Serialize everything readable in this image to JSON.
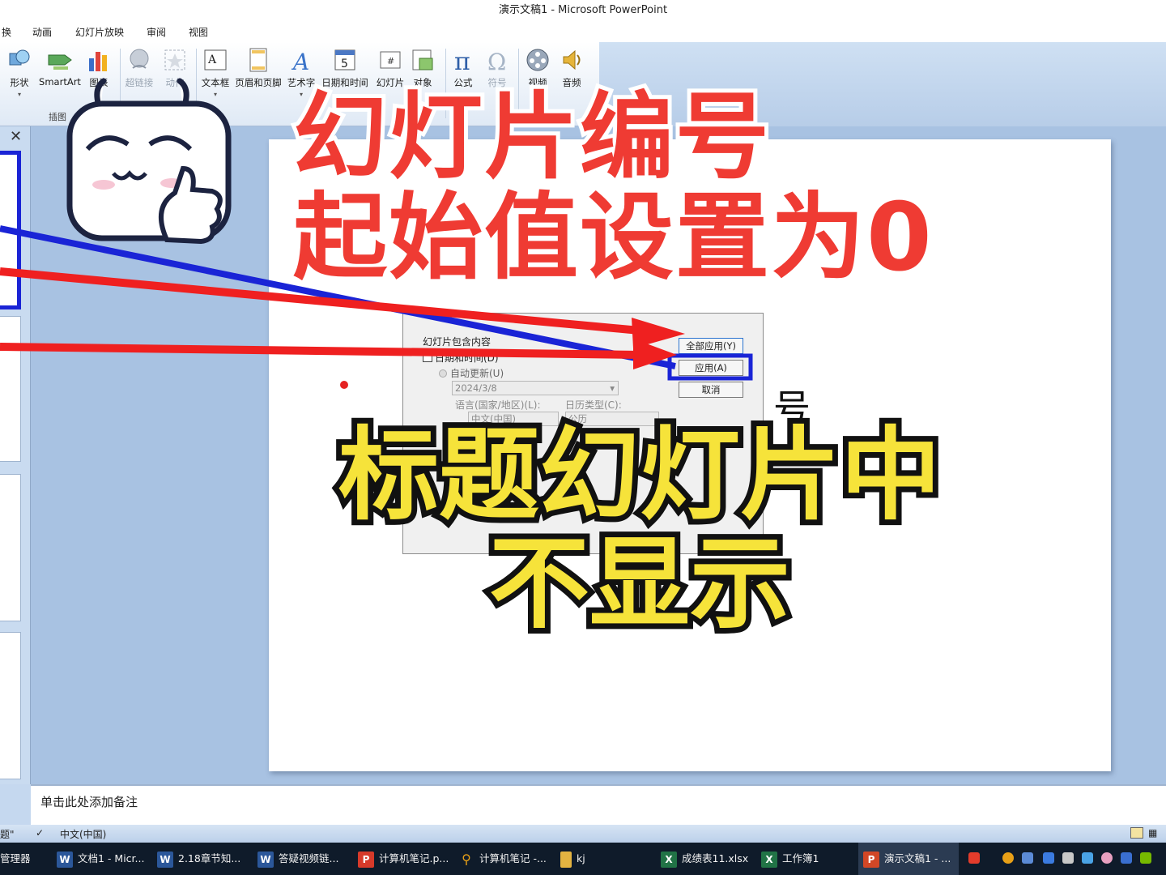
{
  "window": {
    "title": "演示文稿1  -  Microsoft PowerPoint"
  },
  "menu_tabs": [
    "换",
    "动画",
    "幻灯片放映",
    "审阅",
    "视图"
  ],
  "ribbon": {
    "buttons": [
      {
        "label": "形状",
        "icon": "shapes-icon",
        "disabled": false
      },
      {
        "label": "SmartArt",
        "icon": "smartart-icon",
        "disabled": false
      },
      {
        "label": "图表",
        "icon": "chart-icon",
        "disabled": false
      },
      {
        "label": "超链接",
        "icon": "hyperlink-icon",
        "disabled": true
      },
      {
        "label": "动作",
        "icon": "action-icon",
        "disabled": true
      },
      {
        "label": "文本框",
        "icon": "textbox-icon",
        "disabled": false
      },
      {
        "label": "页眉和页脚",
        "icon": "header-footer-icon",
        "disabled": false
      },
      {
        "label": "艺术字",
        "icon": "wordart-icon",
        "disabled": false
      },
      {
        "label": "日期和时间",
        "icon": "date-time-icon",
        "disabled": false
      },
      {
        "label": "幻灯片",
        "icon": "slide-number-icon",
        "disabled": false
      },
      {
        "label": "对象",
        "icon": "object-icon",
        "disabled": false
      },
      {
        "label": "公式",
        "icon": "pi-icon",
        "disabled": false
      },
      {
        "label": "符号",
        "icon": "omega-icon",
        "disabled": true
      },
      {
        "label": "视频",
        "icon": "video-reel-icon",
        "disabled": false
      },
      {
        "label": "音频",
        "icon": "speaker-icon",
        "disabled": false
      }
    ],
    "group_label": "插图"
  },
  "dialog": {
    "section_label": "幻灯片包含内容",
    "date_time_checkbox": "日期和时间(D)",
    "auto_update_radio": "自动更新(U)",
    "date_value": "2024/3/8",
    "language_label": "语言(国家/地区)(L):",
    "calendar_label": "日历类型(C):",
    "language_value": "中文(中国)",
    "calendar_value": "公历",
    "apply_all_button": "全部应用(Y)",
    "apply_button": "应用(A)",
    "cancel_button": "取消"
  },
  "slide": {
    "visible_char": "号"
  },
  "overlay": {
    "red_line1": "幻灯片编号",
    "red_line2": "起始值设置为0",
    "yellow_line1": "标题幻灯片中",
    "yellow_line2": "不显示",
    "colors": {
      "red": "#ef3b33",
      "yellow": "#f6e33a",
      "blue_box": "#1a24d6"
    }
  },
  "notes": {
    "placeholder": "单击此处添加备注"
  },
  "status": {
    "left": "题\"",
    "language": "中文(中国)"
  },
  "taskbar": {
    "items": [
      {
        "label": "管理器",
        "icon": "folder-icon",
        "color": "#d9a520",
        "letter": ""
      },
      {
        "label": "文档1 - Micr...",
        "icon": "word-icon",
        "color": "#2b579a",
        "letter": "W"
      },
      {
        "label": "2.18章节知...",
        "icon": "word-icon",
        "color": "#2b579a",
        "letter": "W"
      },
      {
        "label": "答疑视频链...",
        "icon": "word-icon",
        "color": "#2b579a",
        "letter": "W"
      },
      {
        "label": "计算机笔记.p...",
        "icon": "pdf-icon",
        "color": "#d73a2a",
        "letter": "P"
      },
      {
        "label": "计算机笔记 -...",
        "icon": "search-icon",
        "color": "#e8a017",
        "letter": "⚲"
      },
      {
        "label": "kj",
        "icon": "folder-icon",
        "color": "#e3b341",
        "letter": ""
      },
      {
        "label": "成绩表11.xlsx",
        "icon": "excel-icon",
        "color": "#217346",
        "letter": "X"
      },
      {
        "label": "工作簿1",
        "icon": "excel-icon",
        "color": "#217346",
        "letter": "X"
      },
      {
        "label": "演示文稿1 - ...",
        "icon": "powerpoint-icon",
        "color": "#d24726",
        "letter": "P"
      }
    ]
  }
}
